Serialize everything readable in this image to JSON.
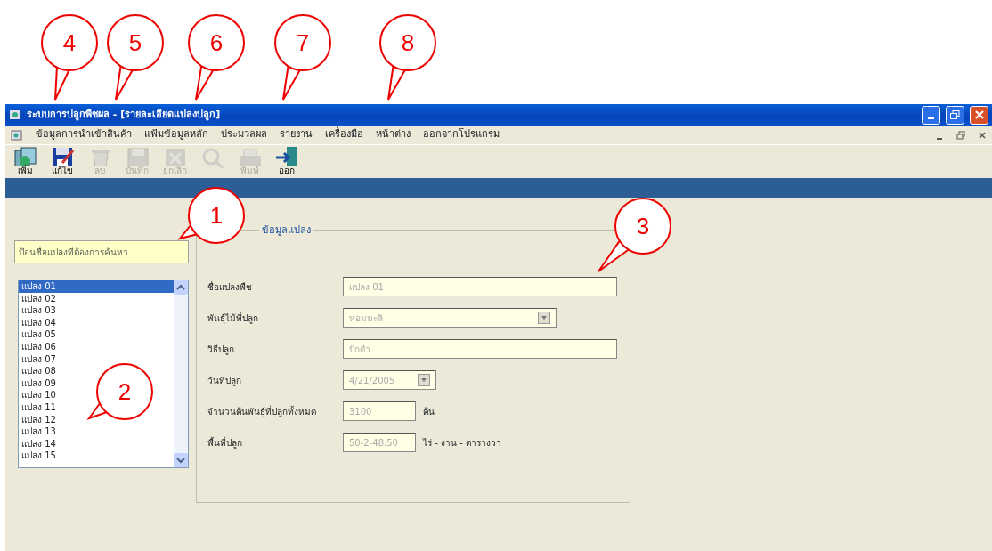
{
  "window": {
    "title": "ระบบการปลูกพืชผล - [รายละเอียดแปลงปลูก]"
  },
  "menu": [
    "ข้อมูลการนำเข้าสินค้า",
    "แฟ้มข้อมูลหลัก",
    "ประมวลผล",
    "รายงาน",
    "เครื่องมือ",
    "หน้าต่าง",
    "ออกจากโปรแกรม"
  ],
  "toolbar": [
    {
      "kind": "add",
      "label": "เพิ่ม",
      "disabled": false
    },
    {
      "kind": "edit",
      "label": "แก้ไข",
      "disabled": false
    },
    {
      "kind": "delete",
      "label": "ลบ",
      "disabled": true
    },
    {
      "kind": "save",
      "label": "บันทึก",
      "disabled": true
    },
    {
      "kind": "cancel",
      "label": "ยกเลิก",
      "disabled": true
    },
    {
      "kind": "search",
      "disabled": true
    },
    {
      "kind": "print",
      "label": "พิมพ์",
      "disabled": true
    },
    {
      "kind": "exit",
      "label": "ออก",
      "disabled": false
    }
  ],
  "search": {
    "placeholder": "ป้อนชื่อแปลงที่ต้องการค้นหา"
  },
  "plots": [
    {
      "label": "แปลง 01",
      "selected": true
    },
    {
      "label": "แปลง 02",
      "selected": false
    },
    {
      "label": "แปลง 03",
      "selected": false
    },
    {
      "label": "แปลง 04",
      "selected": false
    },
    {
      "label": "แปลง 05",
      "selected": false
    },
    {
      "label": "แปลง 06",
      "selected": false
    },
    {
      "label": "แปลง 07",
      "selected": false
    },
    {
      "label": "แปลง 08",
      "selected": false
    },
    {
      "label": "แปลง 09",
      "selected": false
    },
    {
      "label": "แปลง 10",
      "selected": false
    },
    {
      "label": "แปลง 11",
      "selected": false
    },
    {
      "label": "แปลง 12",
      "selected": false
    },
    {
      "label": "แปลง 13",
      "selected": false
    },
    {
      "label": "แปลง 14",
      "selected": false
    },
    {
      "label": "แปลง 15",
      "selected": false
    }
  ],
  "details": {
    "title": "ข้อมูลแปลง",
    "fields": [
      {
        "kind": "text",
        "label": "ชื่อแปลงพืช",
        "value": "แปลง 01"
      },
      {
        "kind": "select",
        "label": "พันธุ์ไม้ที่ปลูก",
        "value": "หอมมะลิ"
      },
      {
        "kind": "text",
        "label": "วิธีปลูก",
        "value": "ปักดำ"
      },
      {
        "kind": "date",
        "label": "วันที่ปลูก",
        "value": "4/21/2005"
      },
      {
        "kind": "unit",
        "label": "จำนวนต้นพันธุ์ที่ปลูกทั้งหมด",
        "value": "3100",
        "unit": "ต้น"
      },
      {
        "kind": "unit",
        "label": "พื้นที่ปลูก",
        "value": "50-2-48.50",
        "unit": "ไร่ - งาน - ตารางวา"
      }
    ]
  },
  "callouts": [
    "4",
    "5",
    "6",
    "7",
    "8",
    "1",
    "3",
    "2"
  ]
}
